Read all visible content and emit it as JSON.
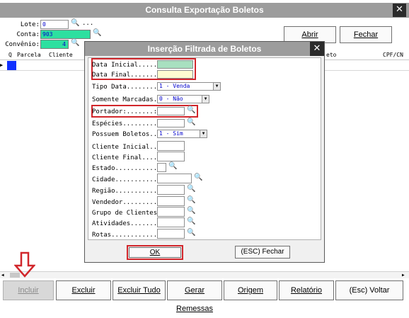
{
  "window": {
    "title": "Consulta Exportação Boletos",
    "close_glyph": "✕"
  },
  "filters": {
    "lote_label": "Lote:",
    "lote_value": "0",
    "ellipsis": "...",
    "conta_label": "Conta:",
    "conta_value": "903",
    "convenio_label": "Convênio:",
    "convenio_value": "4"
  },
  "top_buttons": {
    "abrir": "Abrir",
    "fechar": "Fechar"
  },
  "grid": {
    "columns": [
      "Q",
      "Parcela",
      "Cliente",
      "eto",
      "CPF/CN"
    ]
  },
  "modal": {
    "title": "Inserção Filtrada de Boletos",
    "close_glyph": "✕",
    "fields": {
      "data_inicial": "Data Inicial.....:",
      "data_final": "Data Final.......:",
      "tipo_data": "Tipo Data........:",
      "tipo_data_value": "1 - Venda",
      "somente_marcadas": "Somente Marcadas.:",
      "somente_marcadas_value": "0 - Não",
      "portador": "Portador:.......:",
      "especies": "Espécies.........:",
      "possuem_boletos": "Possuem Boletos..:",
      "possuem_boletos_value": "1 - Sim",
      "cliente_inicial": "Cliente Inicial..:",
      "cliente_final": "Cliente Final....:",
      "estado": "Estado...........:",
      "cidade": "Cidade...........:",
      "regiao": "Região...........:",
      "vendedor": "Vendedor.........:",
      "grupo_clientes": "Grupo de Clientes:",
      "atividades": "Atividades.......:",
      "rotas": "Rotas............:"
    },
    "ok": "OK",
    "esc_fechar": "(ESC) Fechar"
  },
  "bottom_buttons": {
    "incluir": "Incluir",
    "excluir": "Excluir",
    "excluir_tudo": "Excluir Tudo",
    "gerar_remessas": "Gerar Remessas",
    "origem": "Origem",
    "relatorio": "Relatório",
    "esc_voltar": "(Esc) Voltar"
  },
  "colors": {
    "highlight": "#d1262b",
    "title_bar": "#9c9c9c",
    "field_green": "#2de0a0"
  }
}
